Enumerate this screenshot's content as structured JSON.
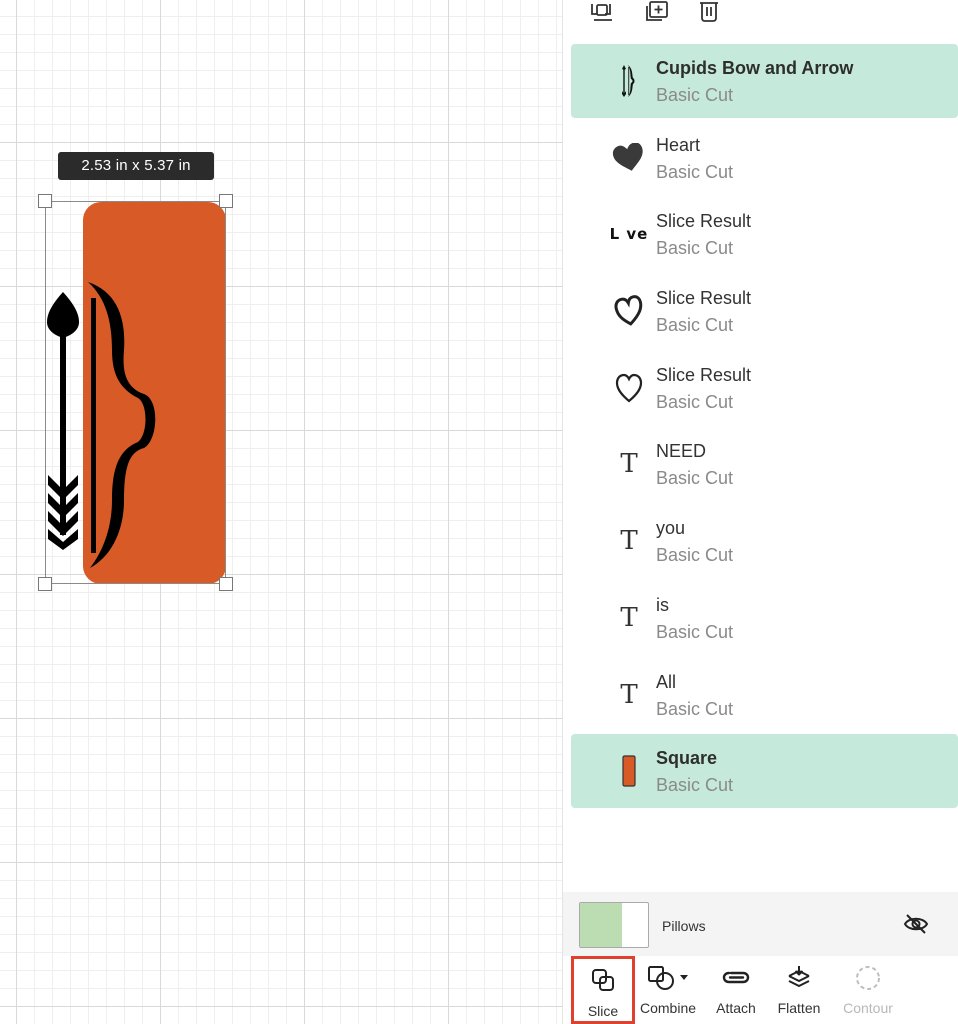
{
  "canvas": {
    "size_label": "2.53  in x 5.37  in",
    "square_color": "#d75a27"
  },
  "layers_panel": {
    "toolbar": [
      {
        "icon": "group-icon"
      },
      {
        "icon": "duplicate-icon"
      },
      {
        "icon": "trash-icon"
      }
    ],
    "layers": [
      {
        "name": "Cupids Bow and Arrow",
        "type": "Basic Cut",
        "thumb": "bow-arrow",
        "selected": true
      },
      {
        "name": "Heart",
        "type": "Basic Cut",
        "thumb": "heart-filled",
        "selected": false
      },
      {
        "name": "Slice Result",
        "type": "Basic Cut",
        "thumb": "lve",
        "thumb_text": "L ve",
        "selected": false
      },
      {
        "name": "Slice Result",
        "type": "Basic Cut",
        "thumb": "heart-outline-bold",
        "selected": false
      },
      {
        "name": "Slice Result",
        "type": "Basic Cut",
        "thumb": "heart-outline",
        "selected": false
      },
      {
        "name": "NEED",
        "type": "Basic Cut",
        "thumb": "text",
        "thumb_text": "T",
        "selected": false
      },
      {
        "name": "you",
        "type": "Basic Cut",
        "thumb": "text",
        "thumb_text": "T",
        "selected": false
      },
      {
        "name": "is",
        "type": "Basic Cut",
        "thumb": "text",
        "thumb_text": "T",
        "selected": false
      },
      {
        "name": "All",
        "type": "Basic Cut",
        "thumb": "text",
        "thumb_text": "T",
        "selected": false
      },
      {
        "name": "Square",
        "type": "Basic Cut",
        "thumb": "square",
        "selected": true
      }
    ],
    "canvas_layer": {
      "label": "Pillows",
      "icon": "eye-slash-icon"
    },
    "actions": [
      {
        "label": "Slice",
        "icon": "slice-icon",
        "enabled": true,
        "highlighted": true
      },
      {
        "label": "Combine",
        "icon": "combine-icon",
        "enabled": true,
        "highlighted": false
      },
      {
        "label": "Attach",
        "icon": "attach-icon",
        "enabled": true,
        "highlighted": false
      },
      {
        "label": "Flatten",
        "icon": "flatten-icon",
        "enabled": true,
        "highlighted": false
      },
      {
        "label": "Contour",
        "icon": "contour-icon",
        "enabled": false,
        "highlighted": false
      }
    ],
    "colors": {
      "selected_bg": "#c5eadc",
      "highlight_border": "#e0412f"
    }
  }
}
